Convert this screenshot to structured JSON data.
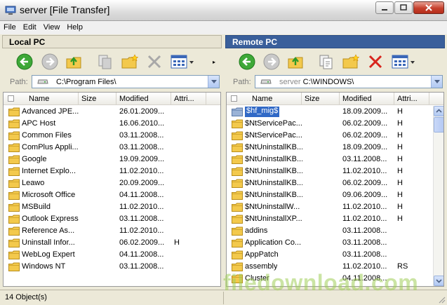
{
  "window": {
    "title": "server [File Transfer]"
  },
  "menu": [
    "File",
    "Edit",
    "View",
    "Help"
  ],
  "local": {
    "header": "Local PC",
    "path_label": "Path:",
    "path": "C:\\Program Files\\",
    "columns": [
      "Name",
      "Size",
      "Modified",
      "Attri..."
    ],
    "rows": [
      {
        "name": "Advanced JPE...",
        "size": "",
        "modified": "26.01.2009...",
        "attr": ""
      },
      {
        "name": "APC Host",
        "size": "",
        "modified": "16.06.2010...",
        "attr": ""
      },
      {
        "name": "Common Files",
        "size": "",
        "modified": "03.11.2008...",
        "attr": ""
      },
      {
        "name": "ComPlus Appli...",
        "size": "",
        "modified": "03.11.2008...",
        "attr": ""
      },
      {
        "name": "Google",
        "size": "",
        "modified": "19.09.2009...",
        "attr": ""
      },
      {
        "name": "Internet Explo...",
        "size": "",
        "modified": "11.02.2010...",
        "attr": ""
      },
      {
        "name": "Leawo",
        "size": "",
        "modified": "20.09.2009...",
        "attr": ""
      },
      {
        "name": "Microsoft Office",
        "size": "",
        "modified": "04.11.2008...",
        "attr": ""
      },
      {
        "name": "MSBuild",
        "size": "",
        "modified": "11.02.2010...",
        "attr": ""
      },
      {
        "name": "Outlook Express",
        "size": "",
        "modified": "03.11.2008...",
        "attr": ""
      },
      {
        "name": "Reference As...",
        "size": "",
        "modified": "11.02.2010...",
        "attr": ""
      },
      {
        "name": "Uninstall Infor...",
        "size": "",
        "modified": "06.02.2009...",
        "attr": "H"
      },
      {
        "name": "WebLog Expert",
        "size": "",
        "modified": "04.11.2008...",
        "attr": ""
      },
      {
        "name": "Windows NT",
        "size": "",
        "modified": "03.11.2008...",
        "attr": ""
      }
    ]
  },
  "remote": {
    "header": "Remote PC",
    "path_label": "Path:",
    "path_server": "server",
    "path": "C:\\WINDOWS\\",
    "columns": [
      "Name",
      "Size",
      "Modified",
      "Attri..."
    ],
    "rows": [
      {
        "name": "$hf_mig$",
        "size": "",
        "modified": "18.09.2009...",
        "attr": "H",
        "selected": true
      },
      {
        "name": "$NtServicePac...",
        "size": "",
        "modified": "06.02.2009...",
        "attr": "H"
      },
      {
        "name": "$NtServicePac...",
        "size": "",
        "modified": "06.02.2009...",
        "attr": "H"
      },
      {
        "name": "$NtUninstallKB...",
        "size": "",
        "modified": "18.09.2009...",
        "attr": "H"
      },
      {
        "name": "$NtUninstallKB...",
        "size": "",
        "modified": "03.11.2008...",
        "attr": "H"
      },
      {
        "name": "$NtUninstallKB...",
        "size": "",
        "modified": "11.02.2010...",
        "attr": "H"
      },
      {
        "name": "$NtUninstallKB...",
        "size": "",
        "modified": "06.02.2009...",
        "attr": "H"
      },
      {
        "name": "$NtUninstallKB...",
        "size": "",
        "modified": "09.06.2009...",
        "attr": "H"
      },
      {
        "name": "$NtUninstallW...",
        "size": "",
        "modified": "11.02.2010...",
        "attr": "H"
      },
      {
        "name": "$NtUninstallXP...",
        "size": "",
        "modified": "11.02.2010...",
        "attr": "H"
      },
      {
        "name": "addins",
        "size": "",
        "modified": "03.11.2008...",
        "attr": ""
      },
      {
        "name": "Application Co...",
        "size": "",
        "modified": "03.11.2008...",
        "attr": ""
      },
      {
        "name": "AppPatch",
        "size": "",
        "modified": "03.11.2008...",
        "attr": ""
      },
      {
        "name": "assembly",
        "size": "",
        "modified": "11.02.2010...",
        "attr": "RS"
      },
      {
        "name": "Cluster",
        "size": "",
        "modified": "04.11.2008...",
        "attr": ""
      }
    ]
  },
  "status": {
    "text": "14 Object(s)"
  },
  "watermark": "filedownload.com",
  "colors": {
    "remote_header": "#3a5f9b",
    "selection": "#3169c6",
    "folder": "#f3c94c"
  }
}
